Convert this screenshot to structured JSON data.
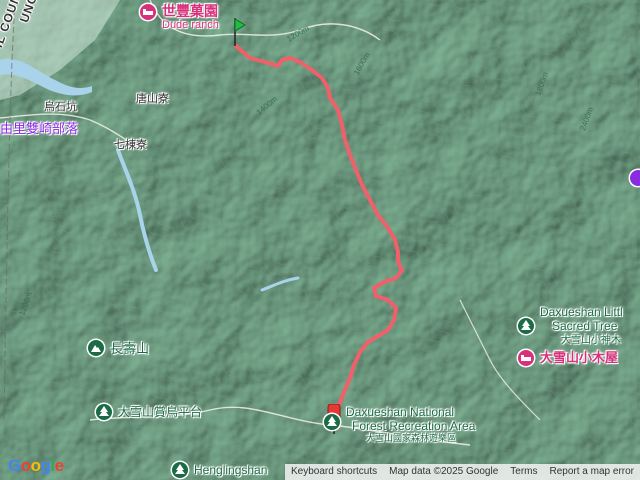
{
  "labels": {
    "shifeng_zh": "世豐菓園",
    "shifeng_en": "Dude ranch",
    "city_edge": "UNG CITY",
    "county_edge": "IL COUNTY",
    "wushikeng": "烏石坑",
    "tangshan": "唐山寮",
    "shuangqi": "由里雙崎部落",
    "qidongliao": "七棟寮",
    "little_tree_en1": "Daxueshan Littl",
    "little_tree_en2": "Sacred Tree",
    "little_tree_zh": "大雪山小神木",
    "cabin": "大雪山小木屋",
    "changshou": "長壽山",
    "bird_platform": "大雪山賞鳥平台",
    "forest_en1": "Daxueshan National",
    "forest_en2": "Forest Recreation Area",
    "forest_zh": "大雪山國家森林遊樂區",
    "henglingshan": "Henglingshan",
    "contour_1200a": "1200m",
    "contour_1200b": "1200m",
    "contour_1400": "1400m",
    "contour_1600": "1600m",
    "contour_2400": "2400m",
    "contour_1800": "1800m"
  },
  "footer": {
    "shortcuts": "Keyboard shortcuts",
    "mapdata": "Map data ©2025 Google",
    "terms": "Terms",
    "report": "Report a map error"
  },
  "logo": [
    "G",
    "o",
    "o",
    "g",
    "l",
    "e"
  ],
  "colors": {
    "route": "#f0606a",
    "start_pin": "#22bb44",
    "end_pin": "#e53935",
    "terrain": "#8fb8a1",
    "water": "#a9d3ea",
    "poi_pink": "#d7317b",
    "poi_green": "#1a6b46"
  },
  "icons": [
    "hotel-icon",
    "tree-icon",
    "mountain-icon",
    "start-flag-icon",
    "end-pin-icon"
  ]
}
